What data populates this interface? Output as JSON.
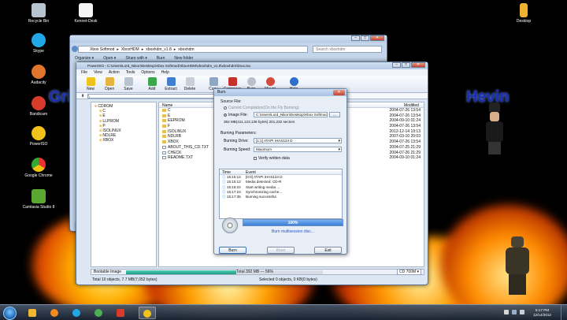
{
  "desktop": {
    "left_icons": [
      {
        "label": "Recycle Bin",
        "icon": "recycle-bin-icon",
        "color": "#b8c4cf"
      },
      {
        "label": "Skype",
        "icon": "skype-icon",
        "color": "#22a7e6"
      },
      {
        "label": "Audacity",
        "icon": "audacity-icon",
        "color": "#e0752b"
      },
      {
        "label": "Bandicam",
        "icon": "bandicam-icon",
        "color": "#d83a2b"
      },
      {
        "label": "PowerISO",
        "icon": "poweriso-icon",
        "color": "#f2c21c"
      },
      {
        "label": "Google Chrome",
        "icon": "chrome-icon",
        "color": "#4caf50"
      },
      {
        "label": "Camtasia Studio 8",
        "icon": "camtasia-icon",
        "color": "#5aa832"
      }
    ],
    "top_icons": [
      {
        "label": "Kennet-Desk",
        "icon": "shortcut-icon",
        "color": "#f4f4f4"
      },
      {
        "label": "Desktop",
        "icon": "desktop-folder-icon",
        "color": "#f0b030"
      }
    ],
    "wallpaper_text_left": "Gri",
    "wallpaper_text_right": "Hevin"
  },
  "explorer": {
    "path": [
      "Xbox Softmod",
      "XboxHDM",
      "xboxhdm_v1.8",
      "xboxhdm"
    ],
    "search_placeholder": "Search xboxhdm",
    "menu": [
      "Organize ▾",
      "Open ▾",
      "Share with ▾",
      "Burn",
      "New folder"
    ]
  },
  "poweriso": {
    "title": "PowerISO - C:\\Users\\Lord_Nikon\\Desktop\\Xbox Softmod\\XboxHDM\\xboxhdm_v1.8\\xboxhdm\\linux.iso",
    "menu": [
      "File",
      "View",
      "Action",
      "Tools",
      "Options",
      "Help"
    ],
    "toolbar": [
      {
        "label": "New",
        "icon": "new-icon",
        "color": "#f2c21c"
      },
      {
        "label": "Open",
        "icon": "open-icon",
        "color": "#e8b440"
      },
      {
        "label": "Save",
        "icon": "save-icon",
        "color": "#b9c3cf"
      },
      {
        "label": "Add",
        "icon": "add-icon",
        "color": "#3aa84a"
      },
      {
        "label": "Extract",
        "icon": "extract-icon",
        "color": "#3f7fd0"
      },
      {
        "label": "Delete",
        "icon": "delete-icon",
        "color": "#c9cfd8"
      },
      {
        "label": "Copy",
        "icon": "copy-icon",
        "color": "#8fa7c4"
      },
      {
        "label": "Compress",
        "icon": "compress-icon",
        "color": "#c7312b"
      },
      {
        "label": "Burn",
        "icon": "burn-icon",
        "color": "#b8c0cc"
      },
      {
        "label": "Mount",
        "icon": "mount-icon",
        "color": "#d24a3a"
      },
      {
        "label": "Help",
        "icon": "help-icon",
        "color": "#2f6fc9"
      }
    ],
    "address": "\\",
    "tree": [
      "CDROM",
      "C",
      "E",
      "LLPROM",
      "P",
      "ISOLINUX",
      "NDLRE",
      "XBOX"
    ],
    "columns": {
      "name": "Name",
      "modified": "Modified"
    },
    "files": [
      {
        "name": "C",
        "type": "folder",
        "modified": "2004-07-26 13:54"
      },
      {
        "name": "E",
        "type": "folder",
        "modified": "2004-07-26 13:54"
      },
      {
        "name": "EEPROM",
        "type": "folder",
        "modified": "2004-09-10 01:24"
      },
      {
        "name": "F",
        "type": "folder",
        "modified": "2004-07-26 13:54"
      },
      {
        "name": "ISOLINUX",
        "type": "folder",
        "modified": "2012-12-14 19:13"
      },
      {
        "name": "NDLRB",
        "type": "folder",
        "modified": "2007-03-10 20:03"
      },
      {
        "name": "XBOX",
        "type": "folder",
        "modified": "2004-07-26 13:54"
      },
      {
        "name": "ABOUT_THIS_CD.TXT",
        "type": "file",
        "modified": "2004-07-25 21:29"
      },
      {
        "name": "CHECK",
        "type": "file",
        "modified": "2004-07-26 21:29"
      },
      {
        "name": "README.TXT",
        "type": "file",
        "modified": "2004-09-10 01:24"
      }
    ],
    "status": {
      "label": "Bootable Image",
      "capacity_text": "Total 392 MB  ---  56%",
      "capacity_fraction": 0.56,
      "media": "CD 700M ▾"
    },
    "footer": [
      "Total 10 objects, 7.7 MB(7,052 bytes)",
      "Selected 0 objects, 0 KB(0 bytes)"
    ]
  },
  "burn_dialog": {
    "title": "Burn",
    "source_label": "Source File:",
    "opt_current": "Current Compilation(On the Fly Burning)",
    "opt_image": "Image File:",
    "image_path": "C:\\Users\\Lord_Nikon\\Desktop\\Xbox Softmod\\XboxHDM\\xboxhdm_v1.8\\xboxhdm\\linux.iso",
    "browse_label": "...",
    "size_text": "392 MB(411,123,136 bytes)  201,232 sectors",
    "params_label": "Burning Parameters:",
    "drive_label": "Burning Drive:",
    "drive_value": "[1:1] ATAPI iHAS124   D",
    "speed_label": "Burning Speed:",
    "speed_value": "Maximum",
    "verify_label": "Verify written data",
    "log_cols": {
      "time": "Time",
      "event": "Event"
    },
    "log": [
      {
        "time": "15:15:12",
        "event": "[0:0] ATAPI iHAS124   D"
      },
      {
        "time": "15:15:12",
        "event": "Media detected: CD-R"
      },
      {
        "time": "15:15:22",
        "event": "Start writing media ..."
      },
      {
        "time": "15:17:24",
        "event": "Synchronizing cache..."
      },
      {
        "time": "15:17:35",
        "event": "Burning successful."
      }
    ],
    "progress_text": "100%",
    "progress_fraction": 1.0,
    "progress_message": "Burn multisession disc...",
    "btn_burn": "Burn",
    "btn_abort": "Abort",
    "btn_exit": "Exit"
  },
  "taskbar": {
    "items": [
      {
        "icon": "explorer-icon",
        "color": "#f0b830",
        "active": false
      },
      {
        "icon": "media-player-icon",
        "color": "#f08a20",
        "active": false
      },
      {
        "icon": "skype-icon",
        "color": "#22a7e6",
        "active": false
      },
      {
        "icon": "chrome-icon",
        "color": "#4caf50",
        "active": false
      },
      {
        "icon": "bandicam-icon",
        "color": "#d83a2b",
        "active": false
      },
      {
        "icon": "poweriso-icon",
        "color": "#f2c21c",
        "active": true
      }
    ],
    "time": "5:17 PM",
    "date": "12/14/2012"
  }
}
